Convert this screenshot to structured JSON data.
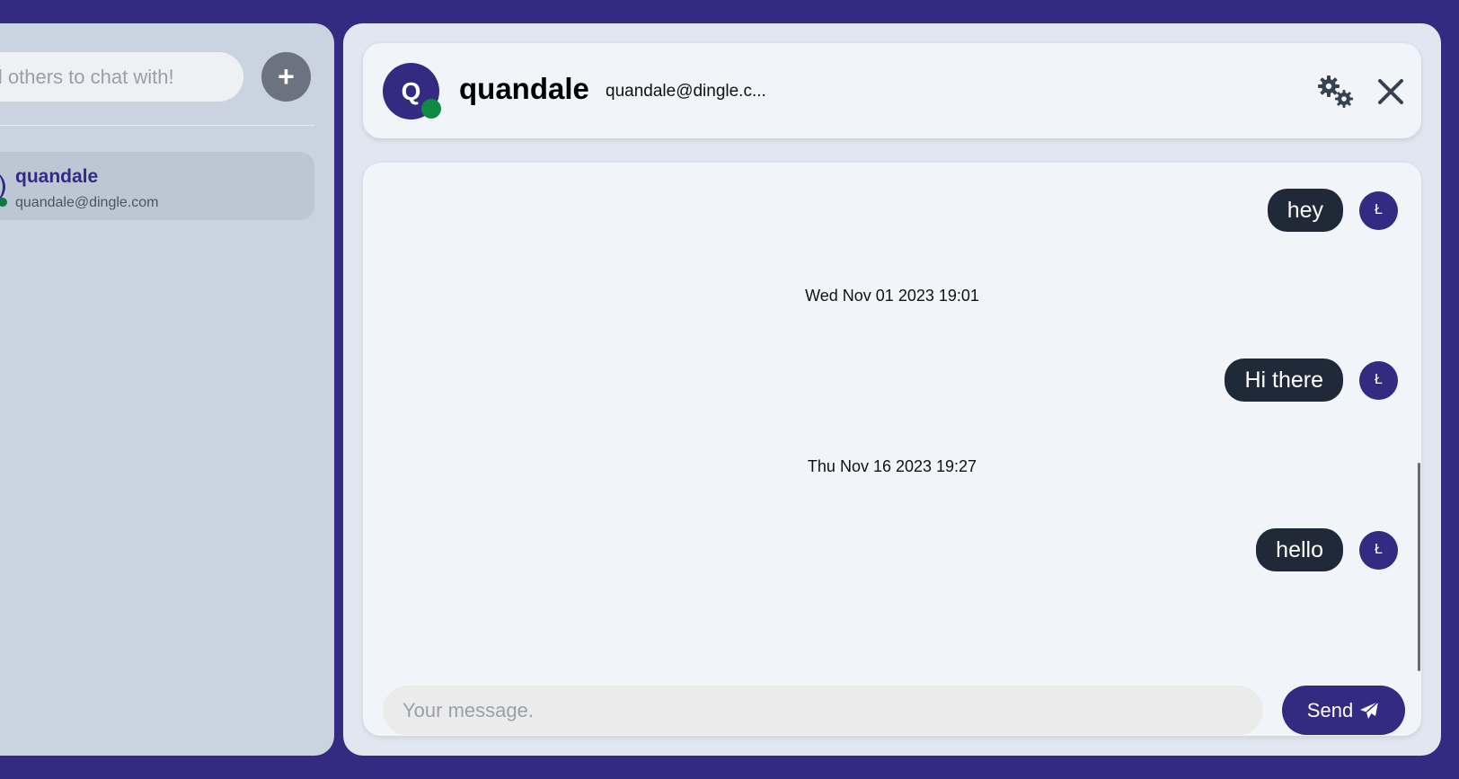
{
  "sidebar": {
    "search_placeholder": "Find others to chat with!",
    "add_label": "+",
    "contacts": [
      {
        "name": "quandale",
        "email": "quandale@dingle.com",
        "status": "online"
      }
    ]
  },
  "chat": {
    "header": {
      "avatar_initial": "Q",
      "name": "quandale",
      "email": "quandale@dingle.c...",
      "status": "online"
    },
    "messages": [
      {
        "text": "hey",
        "avatar_initial": "Ł"
      },
      {
        "timestamp": "Wed Nov 01 2023 19:01"
      },
      {
        "text": "Hi there",
        "avatar_initial": "Ł"
      },
      {
        "timestamp": "Thu Nov 16 2023 19:27"
      },
      {
        "text": "hello",
        "avatar_initial": "Ł"
      }
    ],
    "composer": {
      "placeholder": "Your message.",
      "send_label": "Send"
    }
  },
  "icons": {
    "add": "plus-icon",
    "settings": "gears-icon",
    "close": "close-icon",
    "send": "paper-plane-icon"
  },
  "colors": {
    "page_background": "#332b82",
    "accent": "#332b82",
    "bubble": "#1f2937",
    "online": "#0f8a43",
    "sidebar": "#c9d4e0",
    "panel": "#e1e7f0",
    "card": "#f1f5f9"
  }
}
